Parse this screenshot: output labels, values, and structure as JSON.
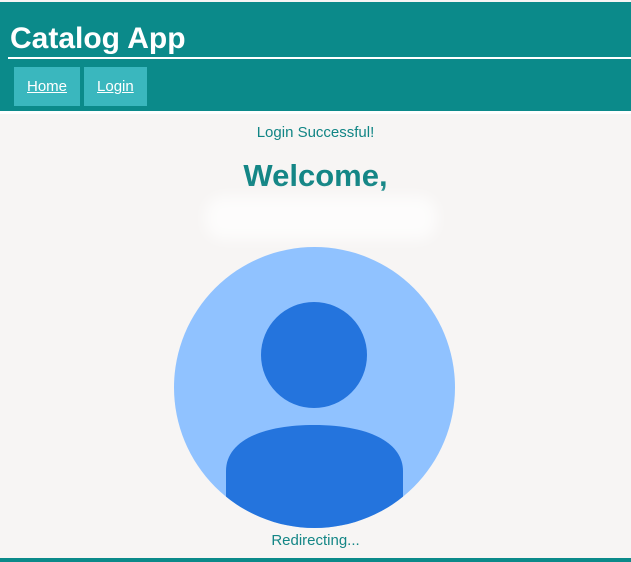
{
  "header": {
    "title": "Catalog App",
    "nav": [
      {
        "label": "Home"
      },
      {
        "label": "Login"
      }
    ]
  },
  "main": {
    "status_message": "Login Successful!",
    "welcome_heading": "Welcome,",
    "avatar_icon": "user-avatar-icon",
    "redirect_message": "Redirecting..."
  },
  "colors": {
    "header_bg": "#0b8a8a",
    "nav_bg": "#3ab7be",
    "page_bg": "#f7f5f4",
    "text_teal": "#148686",
    "avatar_bg": "#90c2ff",
    "avatar_figure": "#2474dd"
  }
}
